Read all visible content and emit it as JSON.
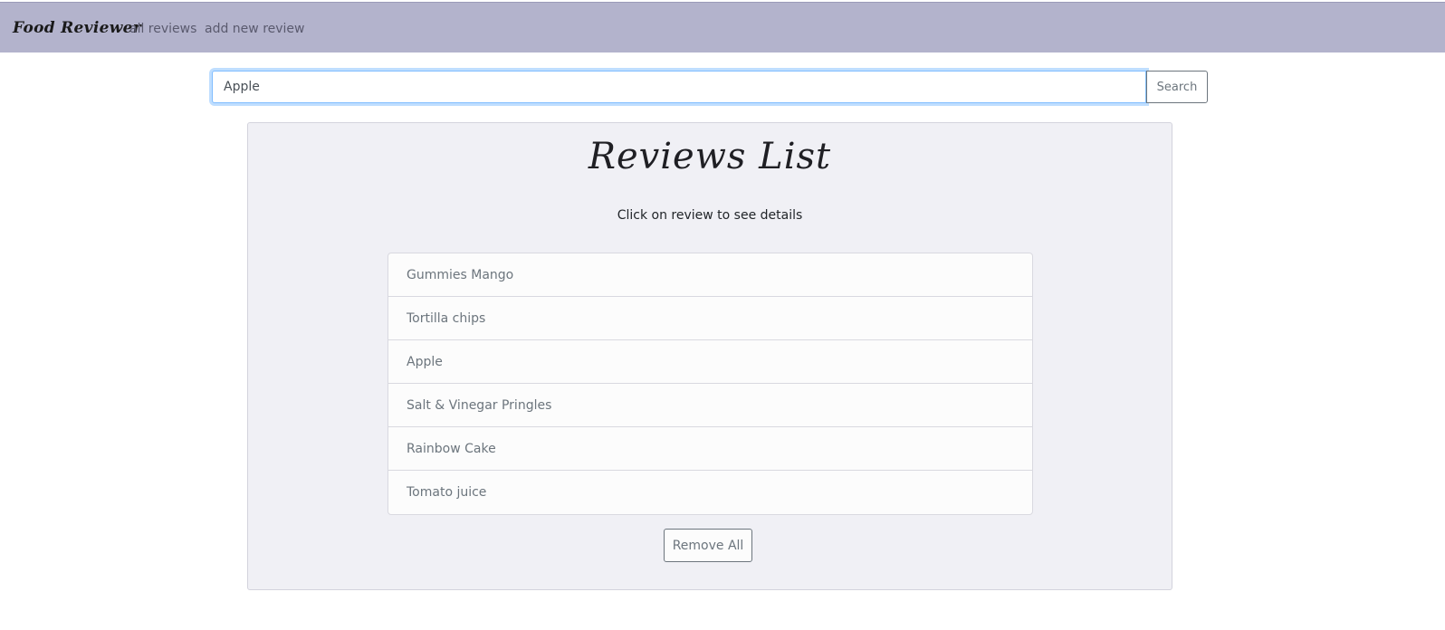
{
  "navbar": {
    "brand": "Food Reviewer",
    "links": [
      "all reviews",
      "add new review"
    ]
  },
  "search": {
    "value": "Apple",
    "button_label": "Search"
  },
  "panel": {
    "title": "Reviews List",
    "subtitle": "Click on review to see details",
    "reviews": [
      "Gummies Mango",
      "Tortilla chips",
      "Apple",
      "Salt & Vinegar Pringles",
      "Rainbow Cake",
      "Tomato juice"
    ],
    "remove_all_label": "Remove All"
  },
  "colors": {
    "navbar_bg": "#b3b3cc",
    "panel_bg": "#f0f0f5",
    "focus_border": "#80bdff"
  }
}
